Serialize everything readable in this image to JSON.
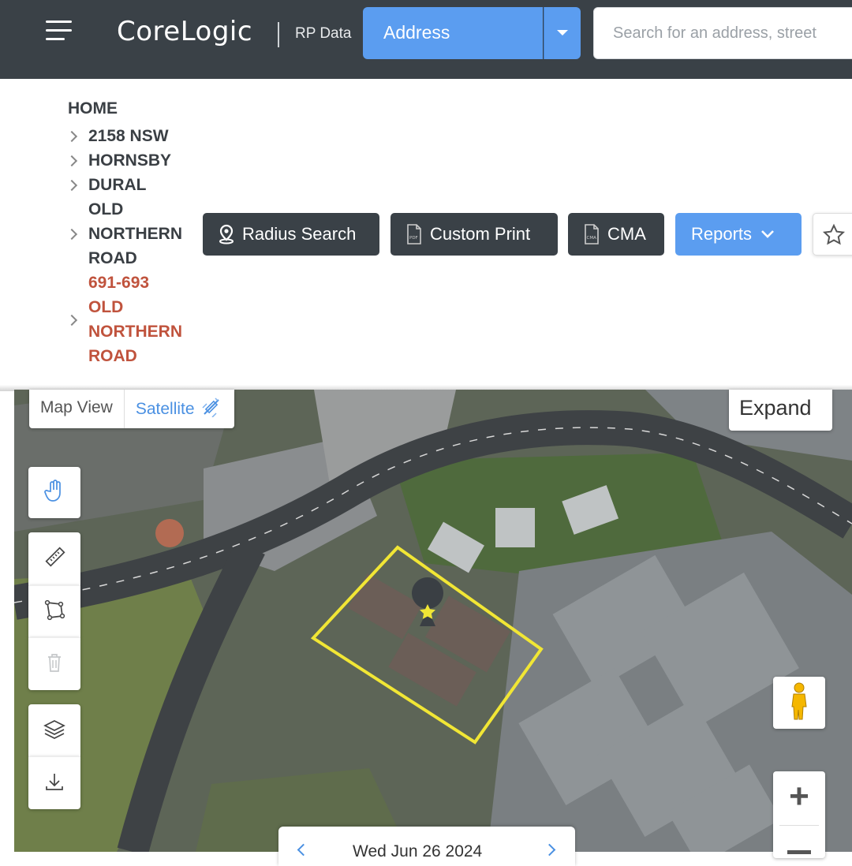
{
  "header": {
    "brand": "CoreLogic",
    "sub_brand": "RP Data",
    "search_mode": "Address",
    "search_placeholder": "Search for an address, street"
  },
  "breadcrumb": {
    "home": "HOME",
    "items": [
      {
        "label": "2158 NSW"
      },
      {
        "label": "HORNSBY"
      },
      {
        "label": "DURAL"
      },
      {
        "label": "OLD NORTHERN ROAD"
      },
      {
        "label": "691-693 OLD NORTHERN ROAD",
        "active": true
      }
    ]
  },
  "toolbar": {
    "radius_search": "Radius Search",
    "custom_print": "Custom Print",
    "cma": "CMA",
    "reports": "Reports"
  },
  "map": {
    "view_map": "Map View",
    "view_satellite": "Satellite",
    "expand": "Expand",
    "date": "Wed Jun 26 2024",
    "tools": [
      "hand-icon",
      "ruler-icon",
      "polygon-icon",
      "trash-icon",
      "layers-icon",
      "download-icon"
    ]
  },
  "colors": {
    "header_bg": "#3a4147",
    "accent_blue": "#5b9df0",
    "active_crumb": "#c0533d",
    "boundary": "#f1e635"
  }
}
